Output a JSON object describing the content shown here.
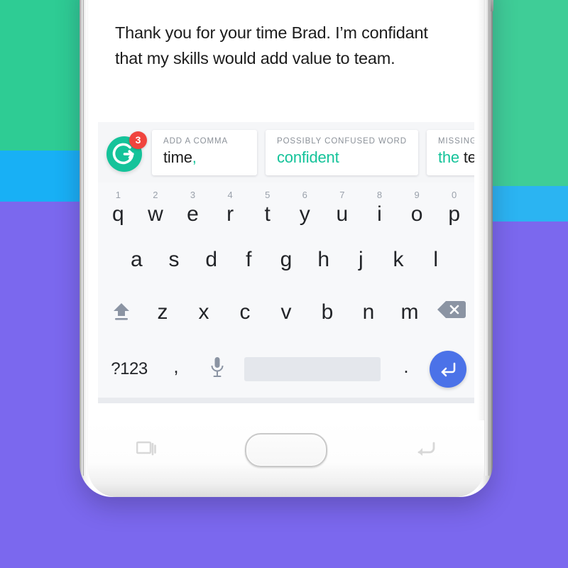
{
  "background": {
    "green": "#2ecc94",
    "blue": "#18b0f5",
    "purple": "#7b68ee"
  },
  "device": {
    "name": "samsung-galaxy-phone",
    "home_button": "home-button",
    "nav_left": "recents-icon",
    "nav_right": "back-icon"
  },
  "compose": {
    "text": "Thank you for your time Brad. I’m confidant that my skills would add value to team."
  },
  "grammarly": {
    "logo_name": "grammarly-logo",
    "badge_count": "3",
    "accent_color": "#15c39a",
    "badge_color": "#f0443e",
    "cards": [
      {
        "label": "ADD A COMMA",
        "value_plain": "time",
        "value_green": ",",
        "order": "plain-first"
      },
      {
        "label": "POSSIBLY CONFUSED WORD",
        "value_plain": "",
        "value_green": "confident",
        "order": "green-only"
      },
      {
        "label": "MISSING W",
        "value_green": "the",
        "value_plain": " tea",
        "order": "green-first"
      }
    ]
  },
  "keyboard": {
    "row1": [
      {
        "letter": "q",
        "num": "1"
      },
      {
        "letter": "w",
        "num": "2"
      },
      {
        "letter": "e",
        "num": "3"
      },
      {
        "letter": "r",
        "num": "4"
      },
      {
        "letter": "t",
        "num": "5"
      },
      {
        "letter": "y",
        "num": "6"
      },
      {
        "letter": "u",
        "num": "7"
      },
      {
        "letter": "i",
        "num": "8"
      },
      {
        "letter": "o",
        "num": "9"
      },
      {
        "letter": "p",
        "num": "0"
      }
    ],
    "row2": [
      {
        "letter": "a"
      },
      {
        "letter": "s"
      },
      {
        "letter": "d"
      },
      {
        "letter": "f"
      },
      {
        "letter": "g"
      },
      {
        "letter": "h"
      },
      {
        "letter": "j"
      },
      {
        "letter": "k"
      },
      {
        "letter": "l"
      }
    ],
    "row3": [
      {
        "letter": "z"
      },
      {
        "letter": "x"
      },
      {
        "letter": "c"
      },
      {
        "letter": "v"
      },
      {
        "letter": "b"
      },
      {
        "letter": "n"
      },
      {
        "letter": "m"
      }
    ],
    "shift_icon": "shift-icon",
    "backspace_icon": "backspace-icon",
    "symbols_label": "?123",
    "comma_label": ",",
    "mic_icon": "microphone-icon",
    "period_label": ".",
    "enter_icon": "enter-return-icon",
    "enter_color": "#4b72e8",
    "spacebar_label": ""
  }
}
